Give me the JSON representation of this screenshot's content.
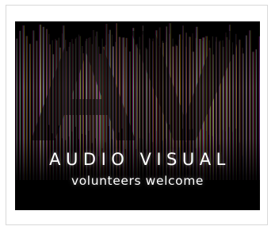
{
  "poster": {
    "big_letters": "AV",
    "title": "AUDIO VISUAL",
    "subtitle": "volunteers welcome"
  },
  "colors": {
    "background": "#000000",
    "frame_border": "#d9d9d9",
    "text": "#ffffff",
    "spectrum": [
      "#7a1a2a",
      "#c2185b",
      "#e91e8c",
      "#9c27b0",
      "#3949ab",
      "#1e88e5",
      "#00bcd4",
      "#2e7d32",
      "#7cb342",
      "#cddc39",
      "#ffc107",
      "#ff9800",
      "#f4511e",
      "#b71c1c"
    ]
  }
}
